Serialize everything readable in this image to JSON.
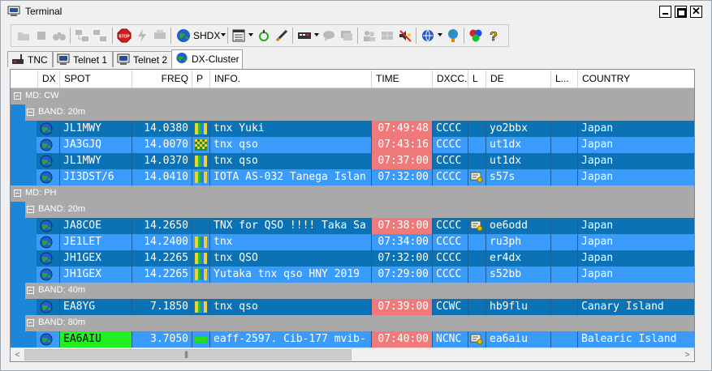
{
  "window": {
    "title": "Terminal"
  },
  "toolbar": {
    "shdx_label": "SHDX",
    "icons": [
      "open-folder-icon",
      "stop-square-icon",
      "binoculars-icon",
      "connect-icon",
      "disconnect-icon",
      "stop-sign-icon",
      "lightning-icon",
      "transfer-icon",
      "globe-icon",
      "filter-list-icon",
      "radio-icon",
      "pen-icon",
      "keyboard-icon",
      "speech-bubble-icon",
      "chat-icon",
      "users-icon",
      "grid-icon",
      "mute-icon",
      "network-icon",
      "world-pin-icon",
      "rgb-circles-icon",
      "help-icon"
    ]
  },
  "tabs": [
    {
      "label": "TNC",
      "icon": "tnc-icon",
      "active": false
    },
    {
      "label": "Telnet 1",
      "icon": "terminal-icon",
      "active": false
    },
    {
      "label": "Telnet 2",
      "icon": "terminal-icon",
      "active": false
    },
    {
      "label": "DX-Cluster",
      "icon": "globe-icon",
      "active": true
    }
  ],
  "columns": {
    "dx": "DX",
    "spot": "SPOT",
    "freq": "FREQ",
    "p": "P",
    "info": "INFO.",
    "time": "TIME",
    "dxcc": "DXCC.",
    "l": "L",
    "de": "DE",
    "l2": "L...",
    "country": "COUNTRY"
  },
  "groups": [
    {
      "mode": "MD: CW",
      "bands": [
        {
          "band": "BAND: 20m",
          "rows": [
            {
              "spot": "JL1MWY",
              "freq": "14.0380",
              "flag": "multi",
              "info": "tnx  Yuki",
              "time": "07:49:48",
              "time_hl": true,
              "dxcc": "CCCC",
              "l_icon": false,
              "de": "yo2bbx",
              "country": "Japan"
            },
            {
              "spot": "JA3GJQ",
              "freq": "14.0070",
              "flag": "checker",
              "info": "tnx qso",
              "time": "07:43:16",
              "time_hl": true,
              "dxcc": "CCCC",
              "l_icon": false,
              "de": "ut1dx",
              "country": "Japan"
            },
            {
              "spot": "JL1MWY",
              "freq": "14.0370",
              "flag": "multi",
              "info": "tnx qso",
              "time": "07:37:00",
              "time_hl": true,
              "dxcc": "CCCC",
              "l_icon": false,
              "de": "ut1dx",
              "country": "Japan"
            },
            {
              "spot": "JI3DST/6",
              "freq": "14.0410",
              "flag": "multi",
              "info": "IOTA AS-032 Tanega Islan",
              "time": "07:32:00",
              "time_hl": false,
              "dxcc": "CCCC",
              "l_icon": true,
              "de": "s57s",
              "country": "Japan"
            }
          ]
        }
      ]
    },
    {
      "mode": "MD: PH",
      "bands": [
        {
          "band": "BAND: 20m",
          "rows": [
            {
              "spot": "JA8COE",
              "freq": "14.2650",
              "flag": "none",
              "info": "TNX for QSO !!!! Taka Sa",
              "time": "07:38:00",
              "time_hl": true,
              "dxcc": "CCCC",
              "l_icon": true,
              "de": "oe6odd",
              "country": "Japan"
            },
            {
              "spot": "JE1LET",
              "freq": "14.2400",
              "flag": "multi",
              "info": "tnx",
              "time": "07:34:00",
              "time_hl": false,
              "dxcc": "CCCC",
              "l_icon": false,
              "de": "ru3ph",
              "country": "Japan"
            },
            {
              "spot": "JH1GEX",
              "freq": "14.2265",
              "flag": "multi",
              "info": "tnx QSO",
              "time": "07:32:00",
              "time_hl": false,
              "dxcc": "CCCC",
              "l_icon": false,
              "de": "er4dx",
              "country": "Japan"
            },
            {
              "spot": "JH1GEX",
              "freq": "14.2265",
              "flag": "multi",
              "info": "Yutaka tnx qso HNY 2019",
              "time": "07:29:00",
              "time_hl": false,
              "dxcc": "CCCC",
              "l_icon": false,
              "de": "s52bb",
              "country": "Japan"
            }
          ]
        },
        {
          "band": "BAND: 40m",
          "rows": [
            {
              "spot": "EA8YG",
              "freq": "7.1850",
              "flag": "multi",
              "info": "tnx qso",
              "time": "07:39:00",
              "time_hl": true,
              "dxcc": "CCWC",
              "l_icon": false,
              "de": "hb9flu",
              "country": "Canary Island"
            }
          ]
        },
        {
          "band": "BAND: 80m",
          "rows": [
            {
              "spot": "EA6AIU",
              "freq": "3.7050",
              "flag": "lime",
              "info": "eaff-2597. Cib-177 mvib-",
              "time": "07:40:00",
              "time_hl": true,
              "dxcc": "NCNC",
              "l_icon": true,
              "de": "ea6aiu",
              "country": "Balearic Island",
              "spot_hl": true
            }
          ]
        }
      ]
    }
  ],
  "colors": {
    "row_dark": "#0a72b5",
    "row_light": "#3a9bfb",
    "group_header": "#a9a9a9",
    "time_highlight": "#f07a7a",
    "spot_highlight": "#22ee22"
  }
}
